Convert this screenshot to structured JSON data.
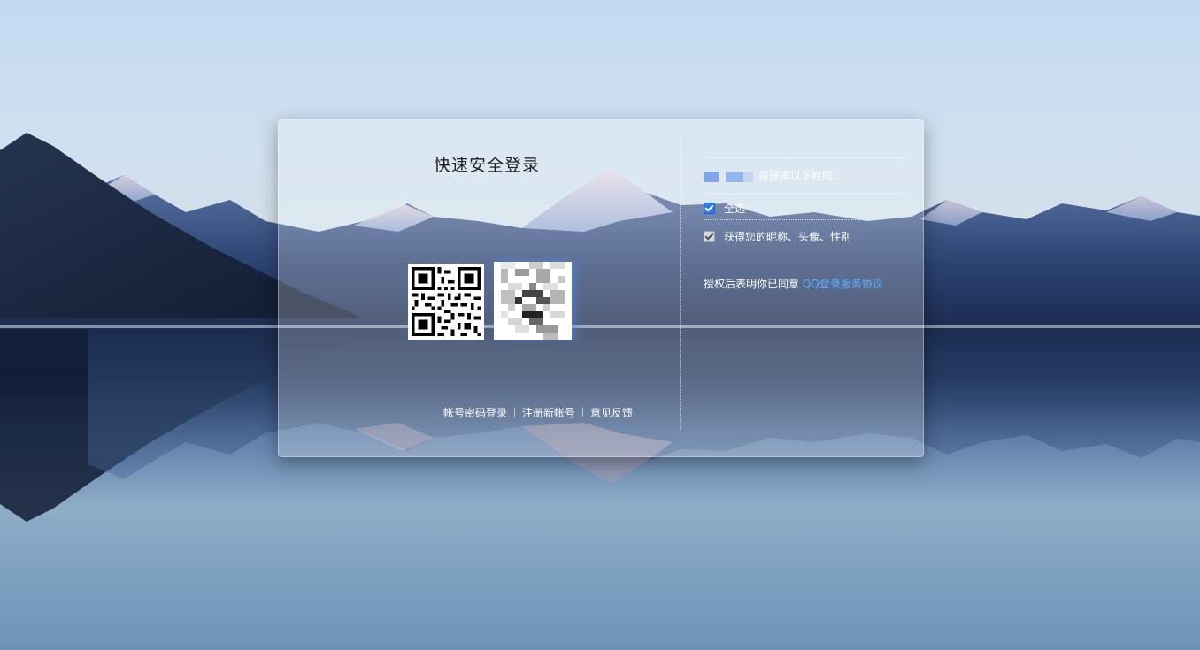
{
  "login": {
    "title": "快速安全登录"
  },
  "links": {
    "account_login": "帐号密码登录",
    "register": "注册新帐号",
    "feedback": "意见反馈"
  },
  "permissions": {
    "header_suffix": "将获得以下权限：",
    "select_all": "全选",
    "select_all_checked": true,
    "profile_info": "获得您的昵称、头像、性别",
    "profile_info_checked": true,
    "agree_prefix": "授权后表明你已同意",
    "agreement_link": "QQ登录服务协议"
  },
  "colors": {
    "link_blue": "#64b1ff",
    "checkbox_blue": "#2d7cf0"
  }
}
